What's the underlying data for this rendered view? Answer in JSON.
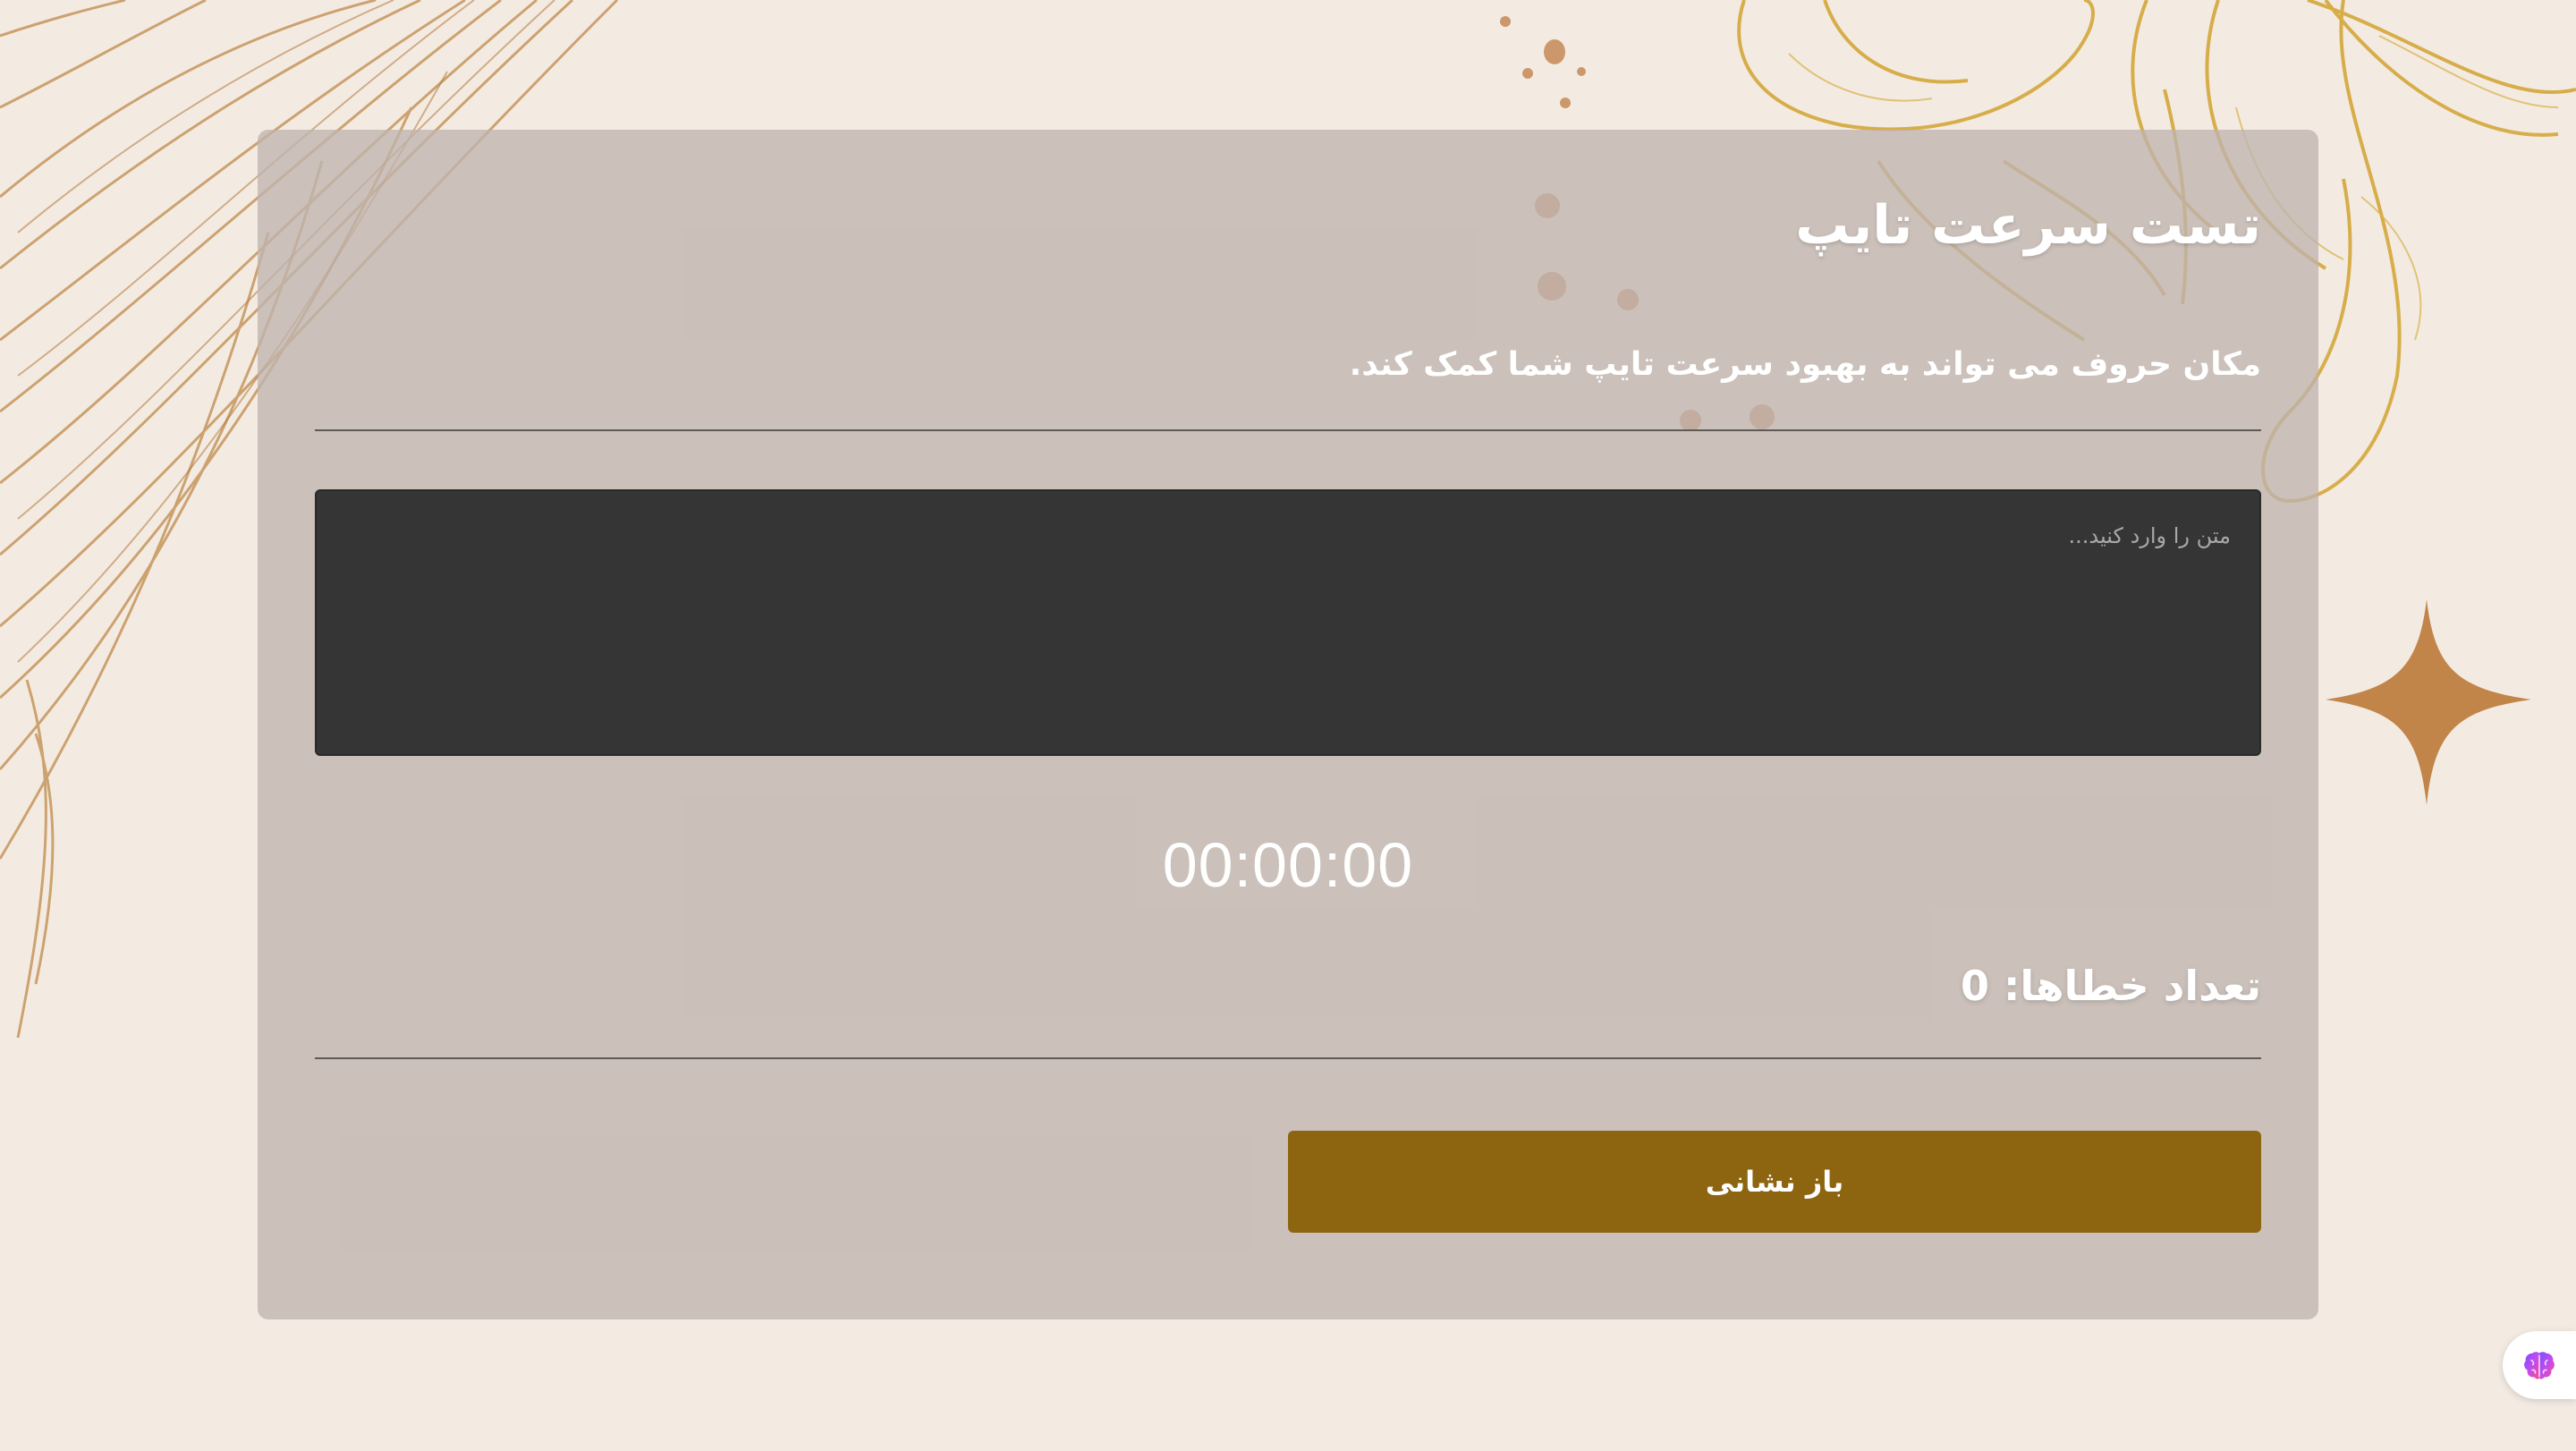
{
  "page": {
    "title": "تست سرعت تایپ",
    "subtitle": "مکان حروف می تواند به بهبود سرعت تایپ شما کمک کند."
  },
  "input": {
    "placeholder": "متن را وارد کنید...",
    "value": ""
  },
  "stats": {
    "timer": "00:00:00",
    "errors": "تعداد خطاها: 0"
  },
  "actions": {
    "reset_label": "باز نشانی"
  },
  "widget": {
    "icon": "brain-icon"
  },
  "colors": {
    "background": "#f3ebe2",
    "card": "#bfb4ae",
    "accent_gold": "#c9a23a",
    "button": "#8d6410",
    "textarea": "#353535",
    "star": "#c1854a"
  }
}
